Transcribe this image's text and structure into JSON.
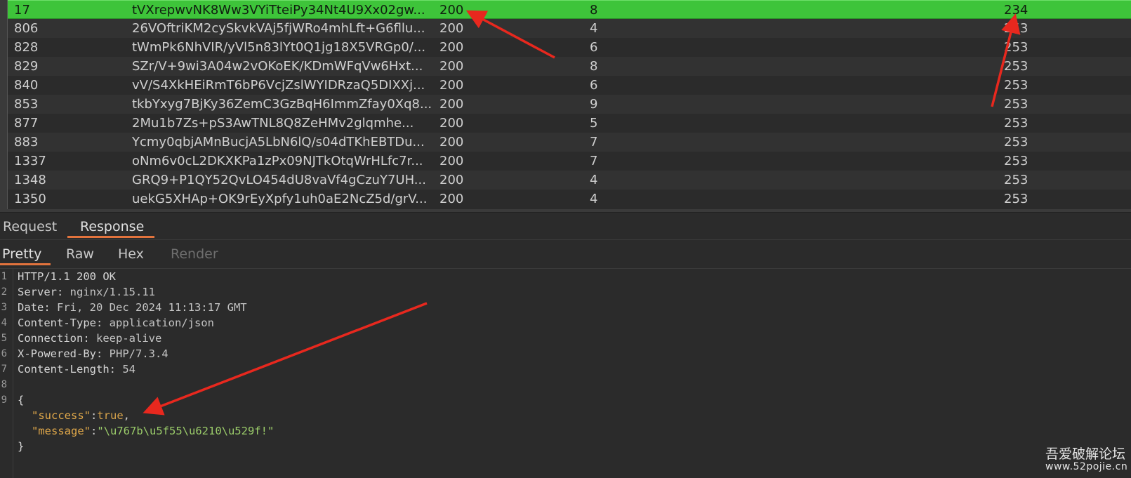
{
  "results": {
    "rows": [
      {
        "id": "17",
        "payload": "tVXrepwvNK8Ww3VYiTteiPy34Nt4U9Xx02gw...",
        "status": "200",
        "error": "8",
        "length": "234",
        "selected": true
      },
      {
        "id": "806",
        "payload": "26VOftriKM2cySkvkVAj5fjWRo4mhLft+G6fllu...",
        "status": "200",
        "error": "4",
        "length": "253"
      },
      {
        "id": "828",
        "payload": "tWmPk6NhVIR/yVl5n83lYt0Q1jg18X5VRGp0/...",
        "status": "200",
        "error": "6",
        "length": "253"
      },
      {
        "id": "829",
        "payload": "SZr/V+9wi3A04w2vOKoEK/KDmWFqVw6Hxt...",
        "status": "200",
        "error": "8",
        "length": "253"
      },
      {
        "id": "840",
        "payload": "vV/S4XkHEiRmT6bP6VcjZslWYIDRzaQ5DIXXj...",
        "status": "200",
        "error": "6",
        "length": "253"
      },
      {
        "id": "853",
        "payload": "tkbYxyg7BjKy36ZemC3GzBqH6ImmZfay0Xq8...",
        "status": "200",
        "error": "9",
        "length": "253"
      },
      {
        "id": "877",
        "payload": "2Mu1b7Zs+pS3AwTNL8Q8ZeHMv2glqmhe...",
        "status": "200",
        "error": "5",
        "length": "253"
      },
      {
        "id": "883",
        "payload": "Ycmy0qbjAMnBucjA5LbN6lQ/s04dTKhEBTDu...",
        "status": "200",
        "error": "7",
        "length": "253"
      },
      {
        "id": "1337",
        "payload": "oNm6v0cL2DKXKPa1zPx09NJTkOtqWrHLfc7r...",
        "status": "200",
        "error": "7",
        "length": "253"
      },
      {
        "id": "1348",
        "payload": "GRQ9+P1QY52QvLO454dU8vaVf4gCzuY7UH...",
        "status": "200",
        "error": "4",
        "length": "253"
      },
      {
        "id": "1350",
        "payload": "uekG5XHAp+OK9rEyXpfy1uh0aE2NcZ5d/grV...",
        "status": "200",
        "error": "4",
        "length": "253"
      }
    ]
  },
  "tabs_main": [
    {
      "label": "Request",
      "active": false
    },
    {
      "label": "Response",
      "active": true
    }
  ],
  "tabs_view": [
    {
      "label": "Pretty",
      "active": true
    },
    {
      "label": "Raw",
      "active": false
    },
    {
      "label": "Hex",
      "active": false
    },
    {
      "label": "Render",
      "active": false,
      "disabled": true
    }
  ],
  "response": {
    "line_numbers": [
      "1",
      "2",
      "3",
      "4",
      "5",
      "6",
      "7",
      "8",
      "9"
    ],
    "status_line": "HTTP/1.1 200 OK",
    "headers": [
      {
        "name": "Server",
        "value": "nginx/1.15.11"
      },
      {
        "name": "Date",
        "value": "Fri, 20 Dec 2024 11:13:17 GMT"
      },
      {
        "name": "Content-Type",
        "value": "application/json"
      },
      {
        "name": "Connection",
        "value": "keep-alive"
      },
      {
        "name": "X-Powered-By",
        "value": "PHP/7.3.4"
      },
      {
        "name": "Content-Length",
        "value": "54"
      }
    ],
    "json_open": "{",
    "json_close": "}",
    "fields": [
      {
        "key": "\"success\"",
        "value": "true",
        "trail": ","
      },
      {
        "key": "\"message\"",
        "value": "\"\\u767b\\u5f55\\u6210\\u529f!\"",
        "trail": ""
      }
    ]
  },
  "watermark": {
    "line1": "吾爱破解论坛",
    "line2": "www.52pojie.cn"
  },
  "colors": {
    "selected_row": "#3ec43a",
    "annotation_arrow": "#e8281e",
    "active_tab_underline": "#e2733d"
  }
}
